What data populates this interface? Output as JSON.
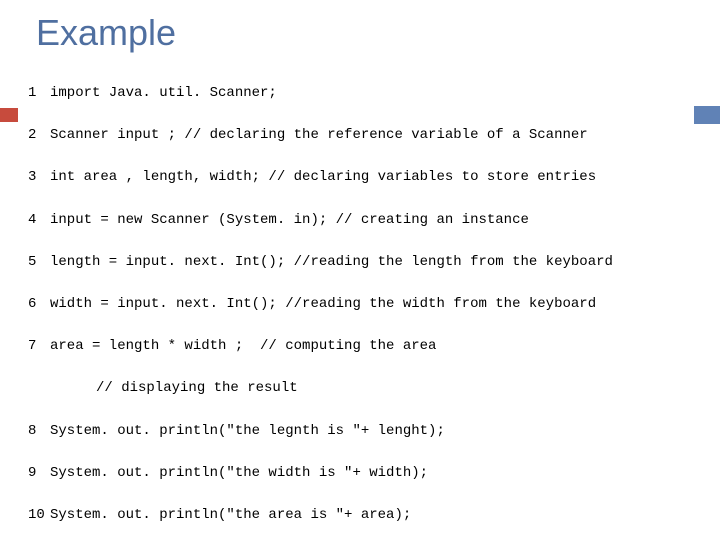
{
  "title": "Example",
  "code_lines": [
    {
      "num": "1",
      "text": "import Java. util. Scanner;"
    },
    {
      "num": "2",
      "text": "Scanner input ; // declaring the reference variable of a Scanner"
    },
    {
      "num": "3",
      "text": "int area , length, width; // declaring variables to store entries"
    },
    {
      "num": "4",
      "text": "input = new Scanner (System. in); // creating an instance"
    },
    {
      "num": "5",
      "text": "length = input. next. Int(); //reading the length from the keyboard"
    },
    {
      "num": "6",
      "text": "width = input. next. Int(); //reading the width from the keyboard"
    },
    {
      "num": "7",
      "text": "area = length * width ;  // computing the area"
    }
  ],
  "indented_comment": "// displaying the result",
  "tail_lines": [
    {
      "num": "8",
      "text": "System. out. println(\"the legnth is \"+ lenght);"
    },
    {
      "num": "9",
      "text": "System. out. println(\"the width is \"+ width);"
    },
    {
      "num": "10",
      "text": "System. out. println(\"the area is \"+ area);"
    }
  ]
}
